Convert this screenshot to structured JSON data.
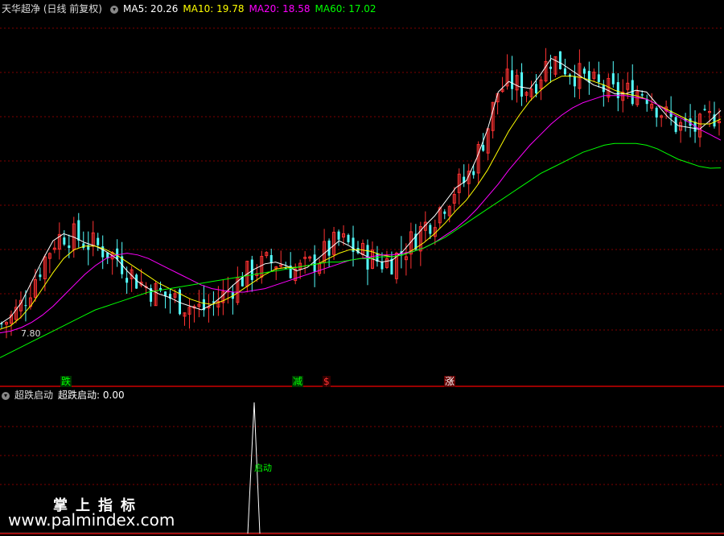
{
  "main_panel": {
    "title": "天华超净 (日线 前复权)",
    "ma_labels": [
      {
        "text": "MA5: 20.26",
        "color": "#ffffff"
      },
      {
        "text": "MA10: 19.78",
        "color": "#ffff00"
      },
      {
        "text": "MA20: 18.58",
        "color": "#ff00ff"
      },
      {
        "text": "MA60: 17.02",
        "color": "#00ff00"
      }
    ],
    "low_label": "7.80",
    "signals": [
      {
        "text": "跌",
        "color": "#00ff00",
        "bg": "#004400"
      },
      {
        "text": "减",
        "color": "#00ff00",
        "bg": "#004400"
      },
      {
        "text": "$",
        "color": "#ff3333",
        "bg": "#440000"
      },
      {
        "text": "涨",
        "color": "#ffffff",
        "bg": "#660000"
      }
    ]
  },
  "sub_panel": {
    "title": "超跌启动",
    "value_label": "超跌启动: 0.00",
    "spike_label": "启动"
  },
  "watermark": {
    "line1": "掌上指标",
    "line2": "www.palmindex.com"
  },
  "colors": {
    "up": "#ff3232",
    "down": "#54ffff",
    "ma5": "#ffffff",
    "ma10": "#ffff00",
    "ma20": "#ff00ff",
    "ma60": "#00ff00",
    "grid": "#800000",
    "border": "#cc0000"
  },
  "chart_data": {
    "type": "line",
    "series": [
      {
        "name": "MA5",
        "values": [
          8.2,
          8.6,
          9.4,
          10.6,
          11.8,
          12.9,
          13.3,
          13.1,
          12.8,
          12.6,
          12.3,
          11.9,
          11.2,
          10.6,
          10.2,
          9.9,
          9.7,
          9.4,
          9.2,
          9.0,
          9.3,
          9.8,
          10.4,
          10.9,
          11.3,
          11.6,
          11.7,
          11.5,
          11.2,
          11.4,
          11.9,
          12.4,
          12.9,
          12.6,
          12.2,
          11.9,
          11.7,
          11.8,
          12.3,
          13.0,
          13.7,
          14.3,
          15.1,
          15.9,
          16.3,
          17.6,
          19.2,
          21.3,
          21.9,
          21.6,
          21.5,
          22.3,
          23.2,
          22.9,
          22.5,
          22.1,
          21.7,
          21.5,
          21.2,
          21.2,
          21.4,
          21.3,
          20.6,
          19.9,
          19.4,
          19.3,
          19.2,
          19.7,
          20.26
        ]
      },
      {
        "name": "MA10",
        "values": [
          7.9,
          8.1,
          8.6,
          9.3,
          10.2,
          11.1,
          11.9,
          12.4,
          12.6,
          12.6,
          12.4,
          12.1,
          11.7,
          11.3,
          10.9,
          10.5,
          10.2,
          9.9,
          9.6,
          9.4,
          9.3,
          9.5,
          9.8,
          10.2,
          10.6,
          11.0,
          11.3,
          11.4,
          11.4,
          11.5,
          11.6,
          11.9,
          12.2,
          12.4,
          12.4,
          12.3,
          12.1,
          12.0,
          12.1,
          12.4,
          12.8,
          13.3,
          13.9,
          14.6,
          15.2,
          16.0,
          16.9,
          18.0,
          19.1,
          20.0,
          20.8,
          21.4,
          21.9,
          22.2,
          22.2,
          22.1,
          21.9,
          21.7,
          21.4,
          21.2,
          21.1,
          20.9,
          20.6,
          20.3,
          20.0,
          19.7,
          19.5,
          19.5,
          19.78
        ]
      },
      {
        "name": "MA20",
        "values": [
          7.7,
          7.8,
          8.0,
          8.3,
          8.7,
          9.2,
          9.8,
          10.4,
          11.0,
          11.5,
          11.9,
          12.1,
          12.2,
          12.1,
          11.9,
          11.6,
          11.3,
          11.0,
          10.7,
          10.4,
          10.2,
          10.1,
          10.0,
          10.0,
          10.1,
          10.2,
          10.4,
          10.6,
          10.8,
          11.0,
          11.2,
          11.4,
          11.6,
          11.8,
          11.9,
          12.0,
          12.1,
          12.1,
          12.2,
          12.3,
          12.5,
          12.8,
          13.2,
          13.6,
          14.1,
          14.7,
          15.4,
          16.1,
          16.9,
          17.6,
          18.3,
          18.9,
          19.5,
          20.0,
          20.4,
          20.7,
          20.9,
          21.1,
          21.1,
          21.1,
          21.0,
          20.9,
          20.6,
          20.2,
          19.9,
          19.6,
          19.2,
          18.9,
          18.58
        ]
      },
      {
        "name": "MA60",
        "values": [
          6.3,
          6.6,
          6.9,
          7.2,
          7.5,
          7.8,
          8.1,
          8.4,
          8.7,
          9.0,
          9.2,
          9.4,
          9.6,
          9.8,
          10.0,
          10.1,
          10.2,
          10.3,
          10.4,
          10.5,
          10.6,
          10.7,
          10.8,
          10.9,
          11.0,
          11.1,
          11.2,
          11.3,
          11.4,
          11.5,
          11.6,
          11.7,
          11.7,
          11.8,
          11.9,
          11.9,
          12.0,
          12.0,
          12.1,
          12.3,
          12.5,
          12.8,
          13.1,
          13.5,
          13.9,
          14.3,
          14.7,
          15.1,
          15.5,
          15.9,
          16.3,
          16.7,
          17.0,
          17.3,
          17.6,
          17.9,
          18.1,
          18.3,
          18.4,
          18.4,
          18.4,
          18.3,
          18.1,
          17.8,
          17.5,
          17.3,
          17.1,
          17.0,
          17.02
        ]
      }
    ],
    "price_range": [
      5.5,
      25.5
    ],
    "signal_index": [
      8,
      40,
      44,
      59,
      96
    ],
    "indicator_spike_index": 34
  }
}
